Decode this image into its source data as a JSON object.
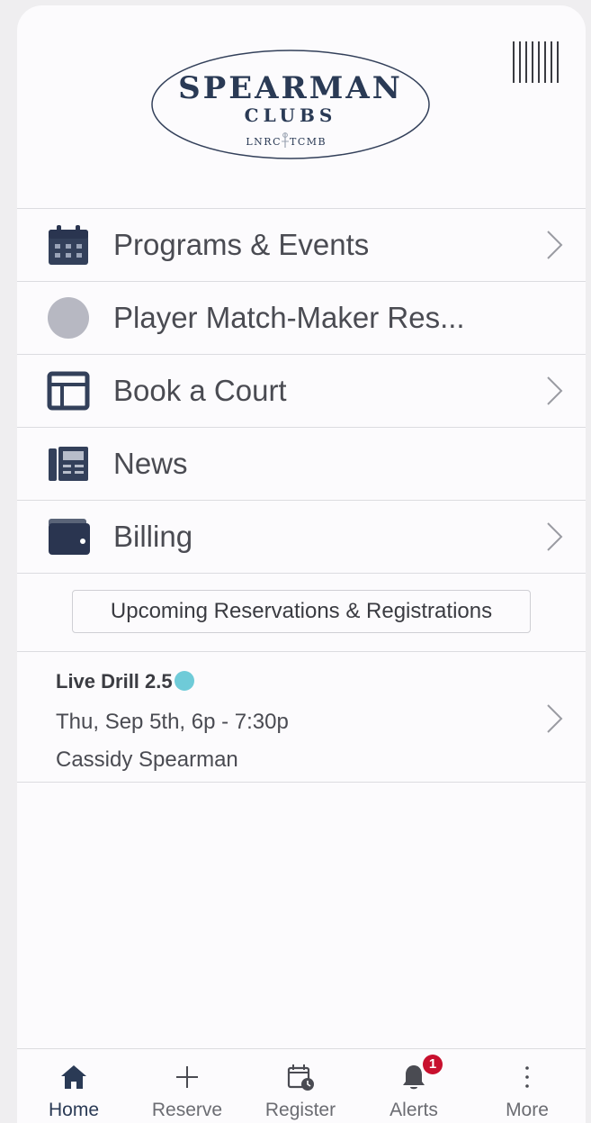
{
  "logo": {
    "line1": "SPEARMAN",
    "line2": "CLUBS",
    "line3_left": "LNRC",
    "line3_right": "TCMB"
  },
  "icons": {
    "barcode": "barcode-icon"
  },
  "menu": [
    {
      "label": "Programs & Events",
      "icon": "calendar-icon",
      "chevron": true
    },
    {
      "label": "Player Match-Maker Res...",
      "icon": "circle-icon",
      "chevron": false
    },
    {
      "label": "Book a Court",
      "icon": "layout-window-icon",
      "chevron": true
    },
    {
      "label": "News",
      "icon": "newspaper-icon",
      "chevron": false
    },
    {
      "label": "Billing",
      "icon": "wallet-icon",
      "chevron": true
    }
  ],
  "upcoming": {
    "label": "Upcoming Reservations & Registrations"
  },
  "reservation": {
    "title": "Live Drill 2.5",
    "time": "Thu, Sep 5th, 6p - 7:30p",
    "coach": "Cassidy Spearman",
    "dot_color": "#6fcbd8"
  },
  "tabs": [
    {
      "label": "Home",
      "icon": "home-icon",
      "active": true
    },
    {
      "label": "Reserve",
      "icon": "plus-icon",
      "active": false
    },
    {
      "label": "Register",
      "icon": "calendar-clock-icon",
      "active": false
    },
    {
      "label": "Alerts",
      "icon": "bell-icon",
      "active": false,
      "badge": "1"
    },
    {
      "label": "More",
      "icon": "more-vertical-icon",
      "active": false
    }
  ],
  "colors": {
    "navy": "#2a3a55",
    "badge": "#c8102e",
    "text": "#4a4b52",
    "circle_gray": "#b7b8c2"
  }
}
